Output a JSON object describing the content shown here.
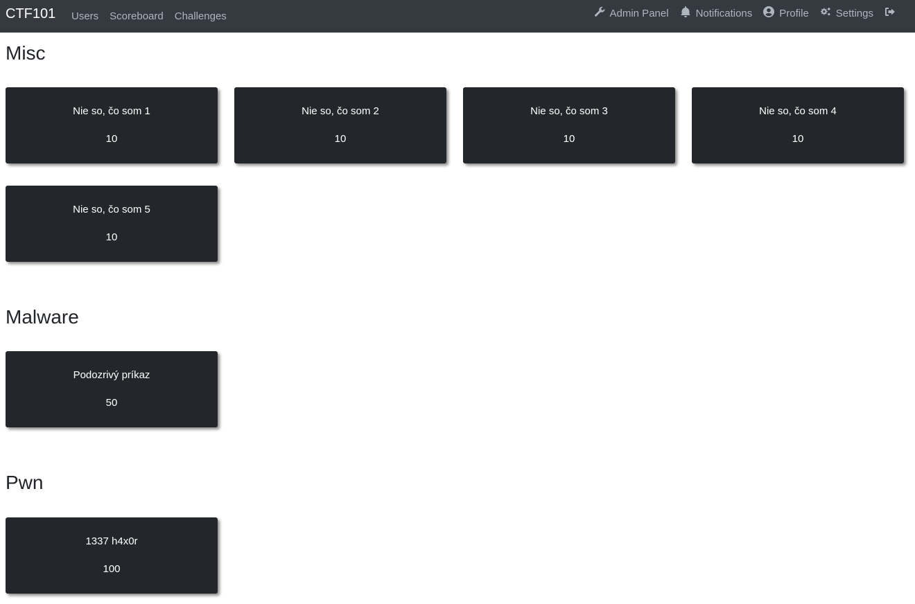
{
  "navbar": {
    "brand": "CTF101",
    "links": [
      "Users",
      "Scoreboard",
      "Challenges"
    ],
    "right": {
      "admin_panel": "Admin Panel",
      "notifications": "Notifications",
      "profile": "Profile",
      "settings": "Settings"
    },
    "icons": {
      "admin_panel": "wrench-icon",
      "notifications": "bell-icon",
      "profile": "user-circle-icon",
      "settings": "cogs-icon",
      "logout": "sign-out-icon"
    }
  },
  "categories": [
    {
      "name": "Misc",
      "challenges": [
        {
          "name": "Nie so, čo som 1",
          "value": "10"
        },
        {
          "name": "Nie so, čo som 2",
          "value": "10"
        },
        {
          "name": "Nie so, čo som 3",
          "value": "10"
        },
        {
          "name": "Nie so, čo som 4",
          "value": "10"
        },
        {
          "name": "Nie so, čo som 5",
          "value": "10"
        }
      ]
    },
    {
      "name": "Malware",
      "challenges": [
        {
          "name": "Podozrivý príkaz",
          "value": "50"
        }
      ]
    },
    {
      "name": "Pwn",
      "challenges": [
        {
          "name": "1337 h4x0r",
          "value": "100"
        }
      ]
    }
  ],
  "colors": {
    "navbar_bg": "#343a40",
    "card_bg": "#23272b",
    "nav_link": "#adb5bd"
  }
}
